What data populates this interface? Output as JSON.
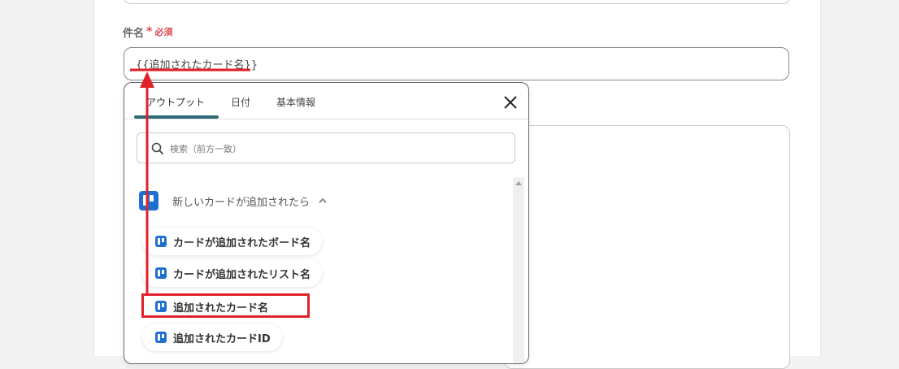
{
  "form": {
    "subject_label": "件名",
    "required_mark": "*",
    "required_text": "必須",
    "subject_value": "{{追加されたカード名}}"
  },
  "picker": {
    "tabs": [
      {
        "label": "アウトプット",
        "active": true
      },
      {
        "label": "日付",
        "active": false
      },
      {
        "label": "基本情報",
        "active": false
      }
    ],
    "close_icon": "close-icon",
    "search_placeholder": "検索（前方一致）",
    "group": {
      "title": "新しいカードが追加されたら",
      "icon": "trello-icon",
      "expanded": true
    },
    "items": [
      {
        "label": "カードが追加されたボード名",
        "icon": "trello-icon"
      },
      {
        "label": "カードが追加されたリスト名",
        "icon": "trello-icon"
      },
      {
        "label": "追加されたカード名",
        "icon": "trello-icon",
        "highlighted": true
      },
      {
        "label": "追加されたカードID",
        "icon": "trello-icon"
      }
    ]
  },
  "annotation": {
    "color": "#e0202a",
    "type": "arrow-and-box"
  },
  "colors": {
    "accent_tab": "#2f6a77",
    "required": "#e0464b",
    "trello": "#1f6fd1"
  }
}
